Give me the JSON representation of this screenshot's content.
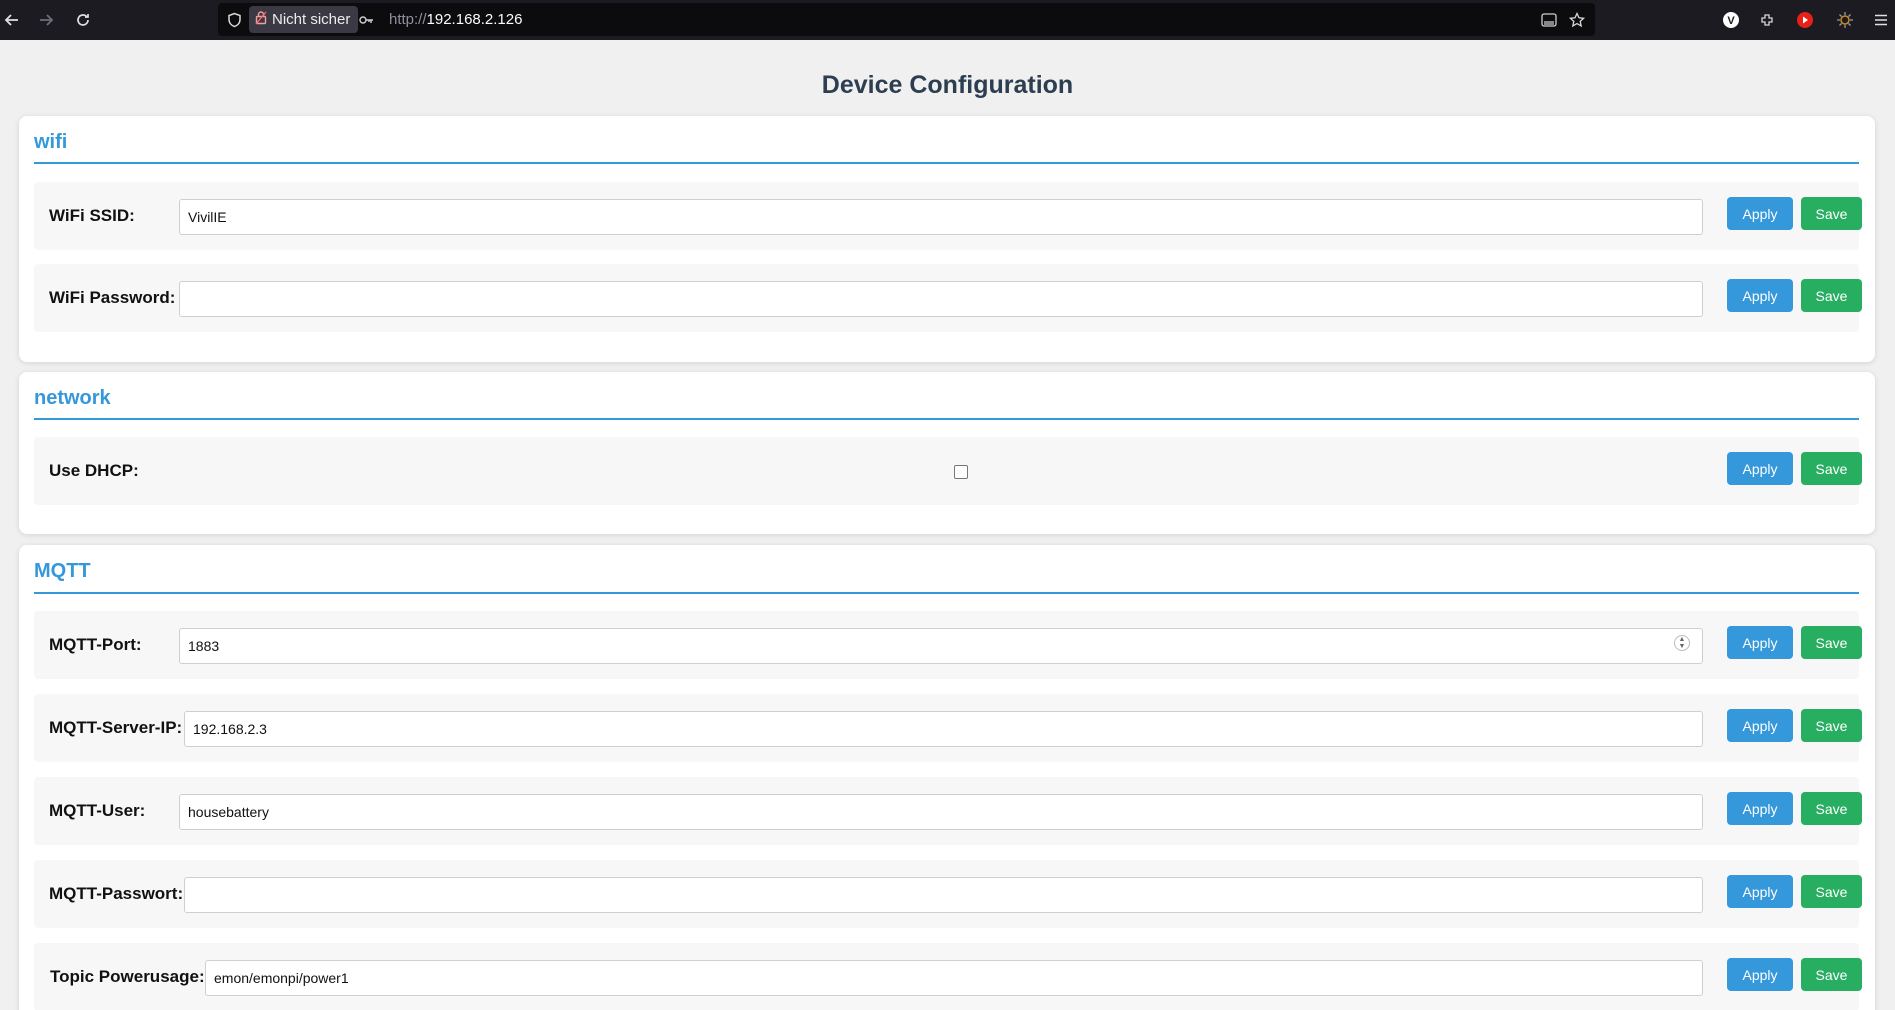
{
  "browser": {
    "security_label": "Nicht sicher",
    "url_protocol": "http://",
    "url_host": "192.168.2.126"
  },
  "page": {
    "title": "Device Configuration"
  },
  "sections": {
    "wifi": {
      "title": "wifi",
      "rows": [
        {
          "label": "WiFi SSID:",
          "value": "VivilIE"
        },
        {
          "label": "WiFi Password:",
          "value": ""
        }
      ]
    },
    "network": {
      "title": "network",
      "rows": [
        {
          "label": "Use DHCP:",
          "checked": false
        }
      ]
    },
    "mqtt": {
      "title": "MQTT",
      "rows": [
        {
          "label": "MQTT-Port:",
          "value": "1883"
        },
        {
          "label": "MQTT-Server-IP:",
          "value": "192.168.2.3"
        },
        {
          "label": "MQTT-User:",
          "value": "housebattery"
        },
        {
          "label": "MQTT-Passwort:",
          "value": ""
        },
        {
          "label": "Topic Powerusage:",
          "value": "emon/emonpi/power1"
        }
      ]
    }
  },
  "buttons": {
    "apply": "Apply",
    "save": "Save"
  },
  "colors": {
    "accent": "#3498db",
    "save": "#27ae60",
    "title": "#2c3e50"
  }
}
